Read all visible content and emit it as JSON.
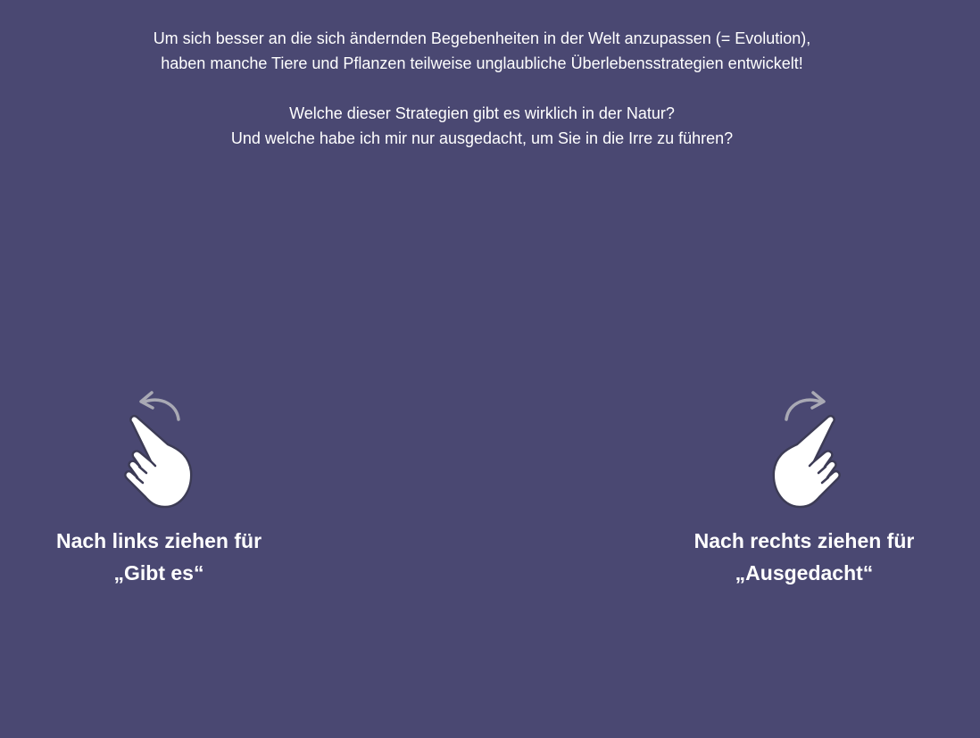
{
  "intro": {
    "line1": "Um sich besser an die sich ändernden Begebenheiten in der Welt anzupassen (= Evolution),",
    "line2": "haben manche Tiere und Pflanzen teilweise unglaubliche Überlebensstrategien entwickelt!",
    "line3": "Welche dieser Strategien gibt es wirklich in der Natur?",
    "line4": "Und welche habe ich mir nur ausgedacht, um Sie in die Irre zu führen?"
  },
  "left_hint": {
    "icon": "swipe-left-hand-icon",
    "line1": "Nach links ziehen für",
    "line2": "„Gibt es“"
  },
  "right_hint": {
    "icon": "swipe-right-hand-icon",
    "line1": "Nach rechts ziehen für",
    "line2": "„Ausgedacht“"
  },
  "colors": {
    "background": "#4a4872",
    "text": "#ffffff",
    "arrow": "#a9a9b4"
  }
}
